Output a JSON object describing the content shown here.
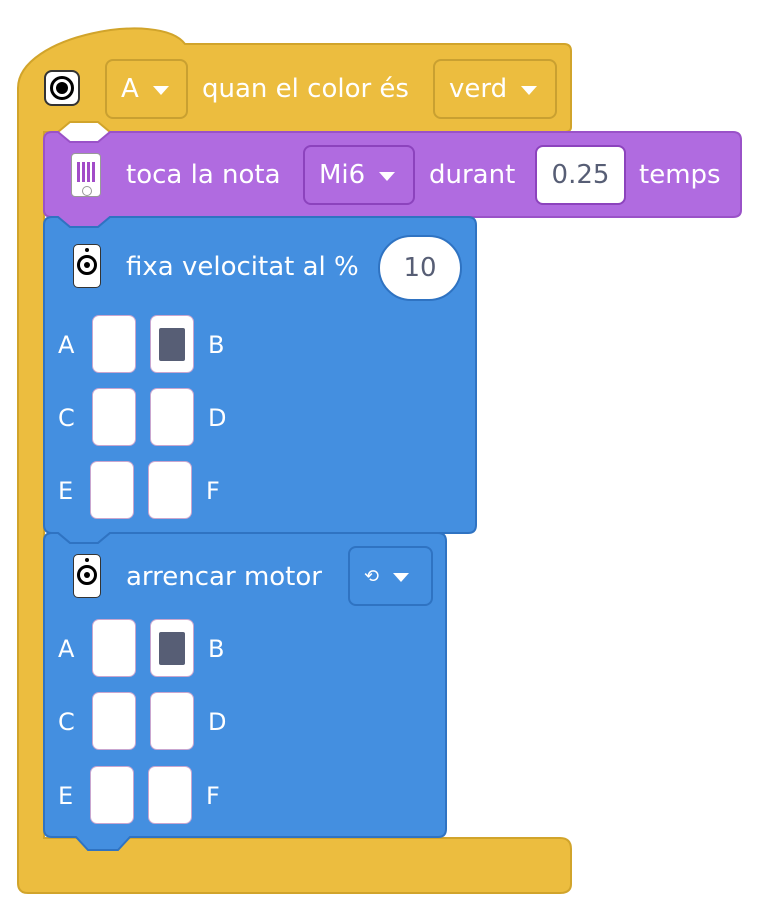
{
  "hat_block": {
    "port_value": "A",
    "label": "quan el color és",
    "color_value": "verd"
  },
  "sound_block": {
    "label": "toca la nota",
    "note_value": "Mi6",
    "label2": "durant",
    "duration_value": "0.25",
    "label3": "temps"
  },
  "speed_block": {
    "label": "fixa velocitat al %",
    "speed_value": "10",
    "ports": [
      {
        "label": "A",
        "selected": false
      },
      {
        "label": "B",
        "selected": true
      },
      {
        "label": "C",
        "selected": false
      },
      {
        "label": "D",
        "selected": false
      },
      {
        "label": "E",
        "selected": false
      },
      {
        "label": "F",
        "selected": false
      }
    ]
  },
  "motor_block": {
    "label": "arrencar motor",
    "direction_symbol": "⟲",
    "ports": [
      {
        "label": "A",
        "selected": false
      },
      {
        "label": "B",
        "selected": true
      },
      {
        "label": "C",
        "selected": false
      },
      {
        "label": "D",
        "selected": false
      },
      {
        "label": "E",
        "selected": false
      },
      {
        "label": "F",
        "selected": false
      }
    ]
  },
  "colors": {
    "events_yellow": "#ecbd3f",
    "events_border": "#d1a42b",
    "sound_purple": "#b06be0",
    "sound_border": "#9a52c8",
    "motor_blue": "#448fe0",
    "motor_border": "#2f73c2"
  }
}
